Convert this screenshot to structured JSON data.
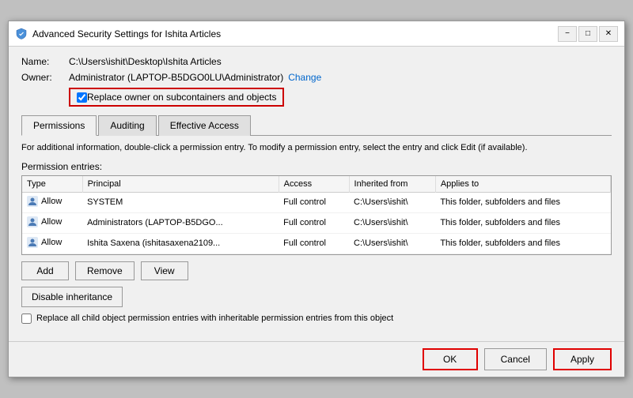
{
  "window": {
    "title": "Advanced Security Settings for Ishita Articles",
    "icon": "shield"
  },
  "titlebar": {
    "minimize_label": "−",
    "maximize_label": "□",
    "close_label": "✕"
  },
  "fields": {
    "name_label": "Name:",
    "name_value": "C:\\Users\\ishit\\Desktop\\Ishita Articles",
    "owner_label": "Owner:",
    "owner_value": "Administrator (LAPTOP-B5DGO0LU\\Administrator)",
    "change_label": "Change",
    "replace_checkbox_label": "Replace owner on subcontainers and objects",
    "replace_checked": true
  },
  "tabs": [
    {
      "id": "permissions",
      "label": "Permissions",
      "active": true
    },
    {
      "id": "auditing",
      "label": "Auditing",
      "active": false
    },
    {
      "id": "effective-access",
      "label": "Effective Access",
      "active": false
    }
  ],
  "info_text": "For additional information, double-click a permission entry. To modify a permission entry, select the entry and click Edit (if available).",
  "permission_entries_label": "Permission entries:",
  "table": {
    "headers": [
      "Type",
      "Principal",
      "Access",
      "Inherited from",
      "Applies to"
    ],
    "rows": [
      {
        "type": "Allow",
        "principal": "SYSTEM",
        "access": "Full control",
        "inherited_from": "C:\\Users\\ishit\\",
        "applies_to": "This folder, subfolders and files"
      },
      {
        "type": "Allow",
        "principal": "Administrators (LAPTOP-B5DGO...",
        "access": "Full control",
        "inherited_from": "C:\\Users\\ishit\\",
        "applies_to": "This folder, subfolders and files"
      },
      {
        "type": "Allow",
        "principal": "Ishita Saxena (ishitasaxena2109...",
        "access": "Full control",
        "inherited_from": "C:\\Users\\ishit\\",
        "applies_to": "This folder, subfolders and files"
      }
    ]
  },
  "buttons": {
    "add": "Add",
    "remove": "Remove",
    "view": "View"
  },
  "disable_inheritance": "Disable inheritance",
  "bottom_checkbox_label": "Replace all child object permission entries with inheritable permission entries from this object",
  "footer": {
    "ok": "OK",
    "cancel": "Cancel",
    "apply": "Apply"
  }
}
